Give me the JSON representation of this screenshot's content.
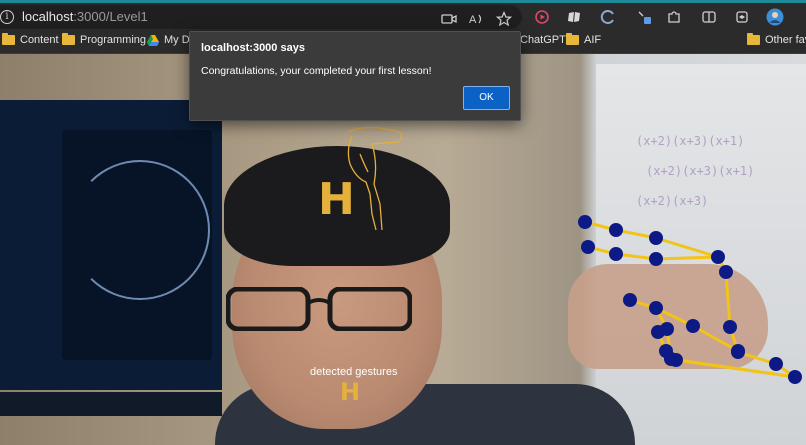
{
  "browser": {
    "url_host": "localhost",
    "url_path": ":3000/Level1",
    "bookmarks": [
      {
        "label": "Content",
        "type": "folder"
      },
      {
        "label": "Programming",
        "type": "folder"
      },
      {
        "label": "My Dr",
        "type": "drive"
      },
      {
        "label": "ChatGPT",
        "type": "page"
      },
      {
        "label": "AIF",
        "type": "folder"
      },
      {
        "label": "Other favo",
        "type": "folder"
      }
    ],
    "toolbar_icons": [
      "camera-icon",
      "read-aloud-icon",
      "favorite-icon",
      "record-icon",
      "extension-icon",
      "history-icon",
      "pen-icon",
      "puzzle-icon",
      "split-screen-icon",
      "collections-icon",
      "profile-avatar"
    ]
  },
  "dialog": {
    "title": "localhost:3000 says",
    "message": "Congratulations, your completed your first lesson!",
    "ok_label": "OK"
  },
  "overlay": {
    "target_letter": "H",
    "detected_label": "detected gestures",
    "detected_letter": "H"
  },
  "colors": {
    "accent_stripe": "#1e8a99",
    "letter": "#e5b13a",
    "landmark_point": "#0d1a86",
    "landmark_line": "#f2c318",
    "dialog_button": "#0b62c4"
  }
}
